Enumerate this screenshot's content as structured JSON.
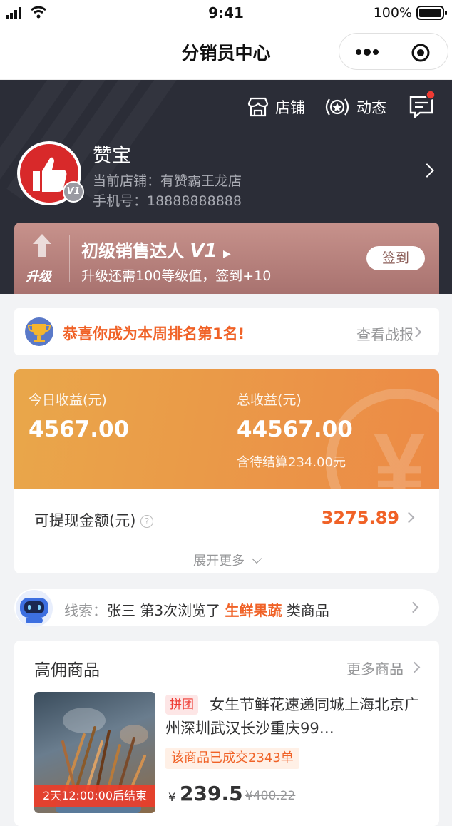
{
  "status_bar": {
    "time": "9:41",
    "battery": "100%"
  },
  "nav": {
    "title": "分销员中心"
  },
  "header": {
    "shop_label": "店铺",
    "feed_label": "动态",
    "user": {
      "name": "赞宝",
      "level_badge": "V1",
      "store": "当前店铺：有赞霸王龙店",
      "phone": "手机号：18888888888"
    },
    "level": {
      "upgrade_label": "升级",
      "title": "初级销售达人",
      "title_level": "V1",
      "desc": "升级还需100等级值，签到+10",
      "signin_label": "签到"
    }
  },
  "rank": {
    "text": "恭喜你成为本周排名第1名!",
    "link": "查看战报"
  },
  "earnings": {
    "today_label": "今日收益(元)",
    "today_value": "4567.00",
    "total_label": "总收益(元)",
    "total_value": "44567.00",
    "pending": "含待结算234.00元",
    "withdraw_label": "可提现金额(元)",
    "withdraw_value": "3275.89",
    "expand_label": "展开更多"
  },
  "clue": {
    "prefix": "线索：",
    "name": "张三",
    "middle": "第3次浏览了",
    "category": "生鲜果蔬",
    "suffix": "类商品"
  },
  "products": {
    "heading": "高佣商品",
    "more": "更多商品",
    "items": [
      {
        "tag": "拼团",
        "title": "女生节鲜花速递同城上海北京广州深圳武汉长沙重庆99…",
        "sold": "该商品已成交2343单",
        "countdown": "2天12:00:00后结束",
        "currency": "¥",
        "price": "239.5",
        "old_price": "¥400.22"
      }
    ]
  },
  "colors": {
    "accent": "#f06227",
    "header_bg": "#2b2d37",
    "avatar_red": "#d8292a"
  }
}
